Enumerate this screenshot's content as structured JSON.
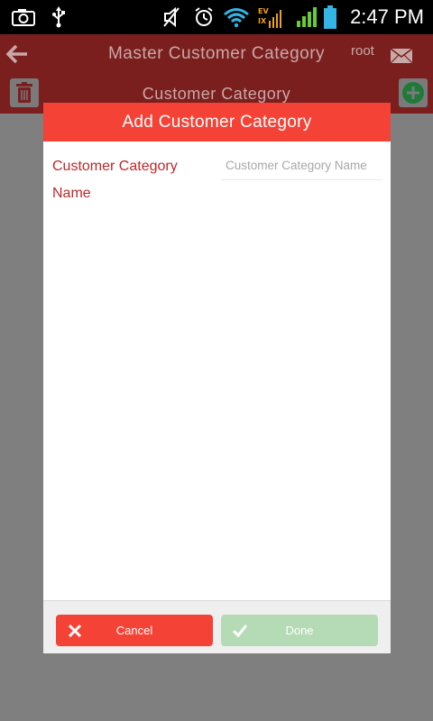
{
  "status_bar": {
    "time": "2:47 PM",
    "network_line1": "EV",
    "network_line2": "IX",
    "icons": [
      "camera-icon",
      "usb-icon",
      "mute-icon",
      "alarm-icon",
      "wifi-icon",
      "network-icon",
      "signal-icon",
      "battery-icon"
    ]
  },
  "header": {
    "title": "Master Customer Category",
    "user": "root",
    "back_icon": "back-arrow-icon",
    "mail_icon": "mail-icon"
  },
  "subheader": {
    "title": "Customer Category",
    "delete_icon": "trash-icon",
    "add_icon": "add-icon"
  },
  "dialog": {
    "title": "Add Customer Category",
    "field_label": "Customer Category Name",
    "field_placeholder": "Customer Category Name",
    "field_value": "",
    "cancel_label": "Cancel",
    "done_label": "Done"
  },
  "colors": {
    "accent": "#f44336",
    "header_dim": "#7a1f1e",
    "overlay": "#7f7f7f",
    "label_red": "#c0282a",
    "done_green_disabled": "#b4dbb5"
  }
}
